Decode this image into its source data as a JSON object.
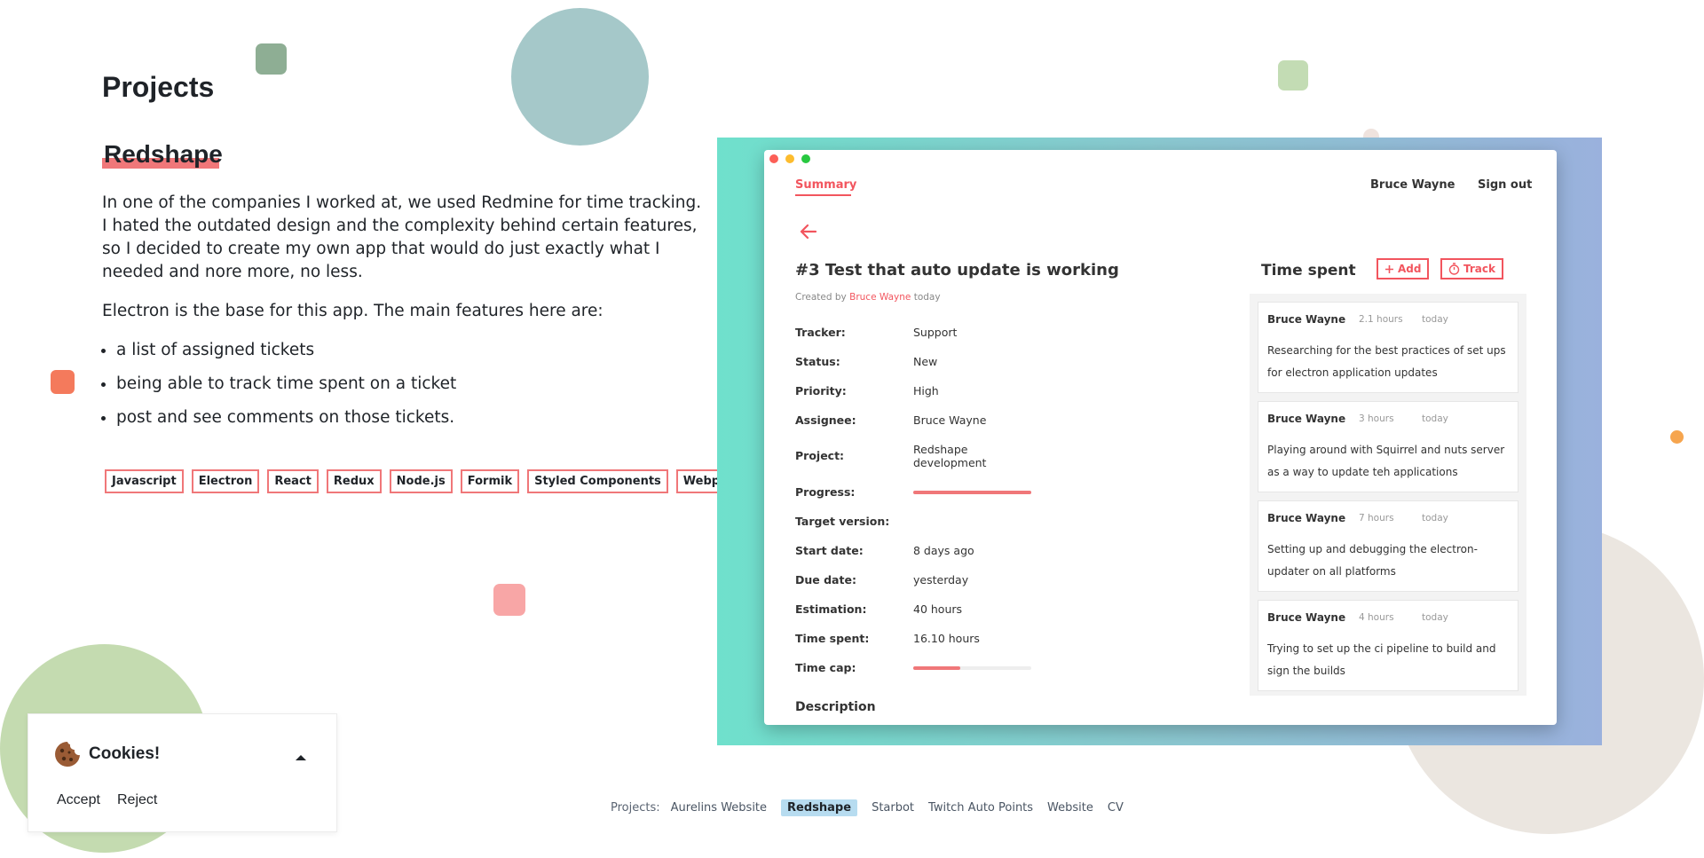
{
  "page": {
    "title": "Projects",
    "project_name": "Redshape",
    "paragraphs": [
      "In one of the companies I worked at, we used Redmine for time tracking. I hated the outdated design and the complexity behind certain features, so I decided to create my own app that would do just exactly what I needed and nore more, no less.",
      "Electron is the base for this app. The main features here are:"
    ],
    "features": [
      "a list of assigned tickets",
      "being able to track time spent on a ticket",
      "post and see comments on those tickets."
    ],
    "tags": [
      "Javascript",
      "Electron",
      "React",
      "Redux",
      "Node.js",
      "Formik",
      "Styled Components",
      "Webpack"
    ]
  },
  "screenshot": {
    "tab": "Summary",
    "user": "Bruce Wayne",
    "signout": "Sign out",
    "issue_title": "#3 Test that auto update is working",
    "created_prefix": "Created by",
    "created_author": "Bruce Wayne",
    "created_when": "today",
    "fields": {
      "tracker": {
        "label": "Tracker:",
        "value": "Support"
      },
      "status": {
        "label": "Status:",
        "value": "New"
      },
      "priority": {
        "label": "Priority:",
        "value": "High"
      },
      "assignee": {
        "label": "Assignee:",
        "value": "Bruce Wayne"
      },
      "project": {
        "label": "Project:",
        "value_line1": "Redshape",
        "value_line2": "development"
      },
      "progress": {
        "label": "Progress:",
        "fraction": 1.0
      },
      "target_version": {
        "label": "Target version:",
        "value": ""
      },
      "start_date": {
        "label": "Start date:",
        "value": "8 days ago"
      },
      "due_date": {
        "label": "Due date:",
        "value": "yesterday"
      },
      "estimation": {
        "label": "Estimation:",
        "value": "40 hours"
      },
      "time_spent": {
        "label": "Time spent:",
        "value": "16.10 hours"
      },
      "time_cap": {
        "label": "Time cap:",
        "fraction": 0.4
      }
    },
    "description_heading": "Description",
    "time_spent_panel": {
      "title": "Time spent",
      "add_label": "Add",
      "track_label": "Track",
      "entries": [
        {
          "user": "Bruce Wayne",
          "hours": "2.1 hours",
          "when": "today",
          "text": "Researching for the best practices of set ups for electron application updates"
        },
        {
          "user": "Bruce Wayne",
          "hours": "3 hours",
          "when": "today",
          "text": "Playing around with Squirrel and nuts server as a way to update teh applications"
        },
        {
          "user": "Bruce Wayne",
          "hours": "7 hours",
          "when": "today",
          "text": "Setting up and debugging the electron-updater on all platforms"
        },
        {
          "user": "Bruce Wayne",
          "hours": "4 hours",
          "when": "today",
          "text": "Trying to set up the ci pipeline to build and sign the builds"
        }
      ]
    }
  },
  "cookie": {
    "title": "Cookies!",
    "accept": "Accept",
    "reject": "Reject"
  },
  "footer": {
    "label": "Projects:",
    "links": [
      "Aurelins Website",
      "Redshape",
      "Starbot",
      "Twitch Auto Points",
      "Website",
      "CV"
    ],
    "active": "Redshape"
  },
  "colors": {
    "accent": "#f07779",
    "app_accent": "#f2555e",
    "active_link_bg": "#b7dcf0"
  }
}
